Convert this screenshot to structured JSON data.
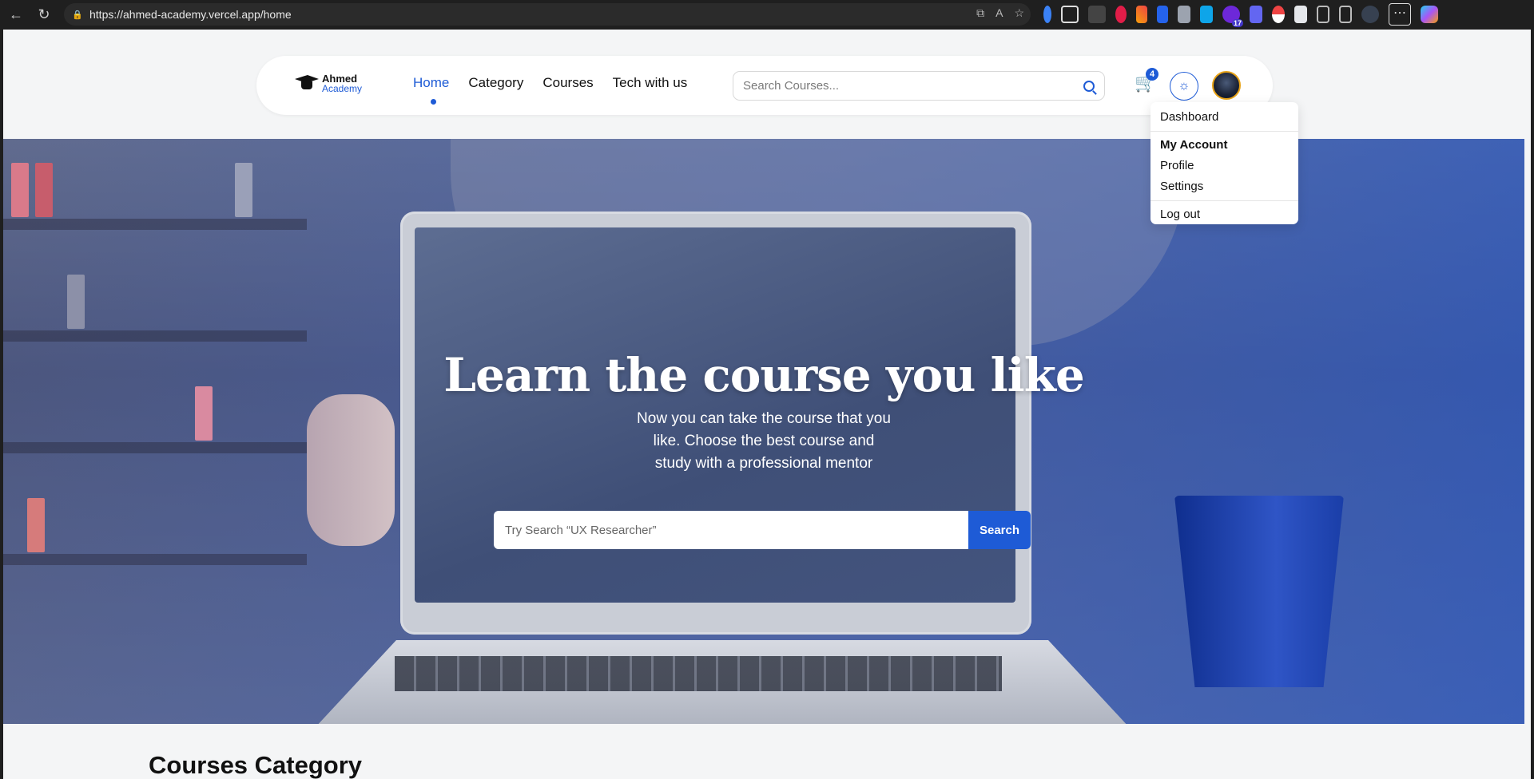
{
  "browser": {
    "url": "https://ahmed-academy.vercel.app/home",
    "extension_badge": "17"
  },
  "nav": {
    "logo_line1": "Ahmed",
    "logo_line2": "Academy",
    "links": [
      {
        "label": "Home",
        "active": true
      },
      {
        "label": "Category",
        "active": false
      },
      {
        "label": "Courses",
        "active": false
      },
      {
        "label": "Tech with us",
        "active": false
      }
    ],
    "search_placeholder": "Search Courses...",
    "cart_count": "4"
  },
  "dropdown": {
    "dashboard": "Dashboard",
    "header": "My Account",
    "profile": "Profile",
    "settings": "Settings",
    "logout": "Log out"
  },
  "hero": {
    "title": "Learn the course you like",
    "subtitle": "Now you can take the course that you like. Choose the best course and study with a professional mentor",
    "search_placeholder": "Try Search “UX Researcher”",
    "search_button": "Search"
  },
  "section": {
    "title": "Courses Category"
  },
  "colors": {
    "accent": "#1e5bd6",
    "avatar_ring": "#e8a317"
  }
}
